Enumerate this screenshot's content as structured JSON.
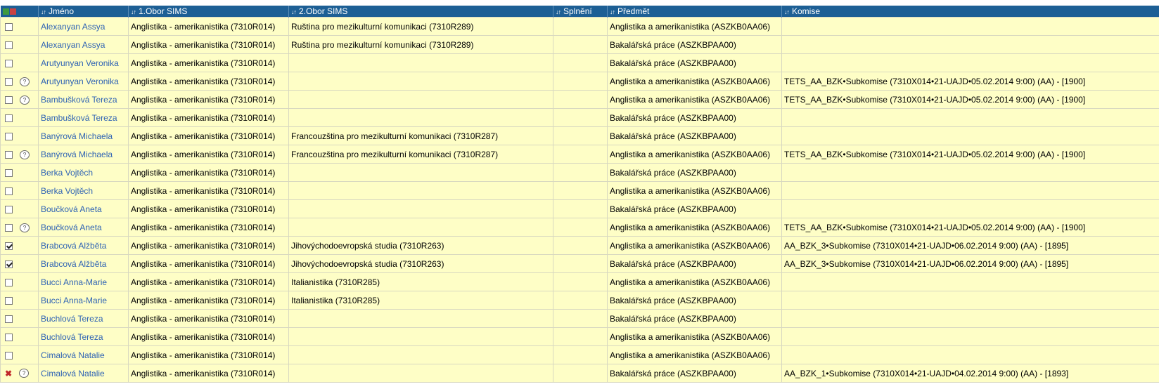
{
  "header": {
    "sort_glyph": "↓↑",
    "columns": [
      "Jméno",
      "1.Obor SIMS",
      "2.Obor SIMS",
      "Splnění",
      "Předmět",
      "Komise"
    ]
  },
  "rows": [
    {
      "checked": false,
      "note": false,
      "x": false,
      "name": "Alexanyan Assya",
      "obor1": "Anglistika - amerikanistika (7310R014)",
      "obor2": "Ruština pro mezikulturní komunikaci (7310R289)",
      "splneni": "",
      "predmet": "Anglistika a amerikanistika (ASZKB0AA06)",
      "komise": ""
    },
    {
      "checked": false,
      "note": false,
      "x": false,
      "name": "Alexanyan Assya",
      "obor1": "Anglistika - amerikanistika (7310R014)",
      "obor2": "Ruština pro mezikulturní komunikaci (7310R289)",
      "splneni": "",
      "predmet": "Bakalářská práce (ASZKBPAA00)",
      "komise": ""
    },
    {
      "checked": false,
      "note": false,
      "x": false,
      "name": "Arutyunyan Veronika",
      "obor1": "Anglistika - amerikanistika (7310R014)",
      "obor2": "",
      "splneni": "",
      "predmet": "Bakalářská práce (ASZKBPAA00)",
      "komise": ""
    },
    {
      "checked": false,
      "note": true,
      "x": false,
      "name": "Arutyunyan Veronika",
      "obor1": "Anglistika - amerikanistika (7310R014)",
      "obor2": "",
      "splneni": "",
      "predmet": "Anglistika a amerikanistika (ASZKB0AA06)",
      "komise": "TETS_AA_BZK•Subkomise (7310X014•21-UAJD•05.02.2014 9:00) (AA) - [1900]"
    },
    {
      "checked": false,
      "note": true,
      "x": false,
      "name": "Bambušková Tereza",
      "obor1": "Anglistika - amerikanistika (7310R014)",
      "obor2": "",
      "splneni": "",
      "predmet": "Anglistika a amerikanistika (ASZKB0AA06)",
      "komise": "TETS_AA_BZK•Subkomise (7310X014•21-UAJD•05.02.2014 9:00) (AA) - [1900]"
    },
    {
      "checked": false,
      "note": false,
      "x": false,
      "name": "Bambušková Tereza",
      "obor1": "Anglistika - amerikanistika (7310R014)",
      "obor2": "",
      "splneni": "",
      "predmet": "Bakalářská práce (ASZKBPAA00)",
      "komise": ""
    },
    {
      "checked": false,
      "note": false,
      "x": false,
      "name": "Banýrová Michaela",
      "obor1": "Anglistika - amerikanistika (7310R014)",
      "obor2": "Francouzština pro mezikulturní komunikaci (7310R287)",
      "splneni": "",
      "predmet": "Bakalářská práce (ASZKBPAA00)",
      "komise": ""
    },
    {
      "checked": false,
      "note": true,
      "x": false,
      "name": "Banýrová Michaela",
      "obor1": "Anglistika - amerikanistika (7310R014)",
      "obor2": "Francouzština pro mezikulturní komunikaci (7310R287)",
      "splneni": "",
      "predmet": "Anglistika a amerikanistika (ASZKB0AA06)",
      "komise": "TETS_AA_BZK•Subkomise (7310X014•21-UAJD•05.02.2014 9:00) (AA) - [1900]"
    },
    {
      "checked": false,
      "note": false,
      "x": false,
      "name": "Berka Vojtěch",
      "obor1": "Anglistika - amerikanistika (7310R014)",
      "obor2": "",
      "splneni": "",
      "predmet": "Bakalářská práce (ASZKBPAA00)",
      "komise": ""
    },
    {
      "checked": false,
      "note": false,
      "x": false,
      "name": "Berka Vojtěch",
      "obor1": "Anglistika - amerikanistika (7310R014)",
      "obor2": "",
      "splneni": "",
      "predmet": "Anglistika a amerikanistika (ASZKB0AA06)",
      "komise": ""
    },
    {
      "checked": false,
      "note": false,
      "x": false,
      "name": "Boučková Aneta",
      "obor1": "Anglistika - amerikanistika (7310R014)",
      "obor2": "",
      "splneni": "",
      "predmet": "Bakalářská práce (ASZKBPAA00)",
      "komise": ""
    },
    {
      "checked": false,
      "note": true,
      "x": false,
      "name": "Boučková Aneta",
      "obor1": "Anglistika - amerikanistika (7310R014)",
      "obor2": "",
      "splneni": "",
      "predmet": "Anglistika a amerikanistika (ASZKB0AA06)",
      "komise": "TETS_AA_BZK•Subkomise (7310X014•21-UAJD•05.02.2014 9:00) (AA) - [1900]"
    },
    {
      "checked": true,
      "note": false,
      "x": false,
      "name": "Brabcová Alžběta",
      "obor1": "Anglistika - amerikanistika (7310R014)",
      "obor2": "Jihovýchodoevropská studia (7310R263)",
      "splneni": "",
      "predmet": "Anglistika a amerikanistika (ASZKB0AA06)",
      "komise": "AA_BZK_3•Subkomise (7310X014•21-UAJD•06.02.2014 9:00) (AA) - [1895]"
    },
    {
      "checked": true,
      "note": false,
      "x": false,
      "name": "Brabcová Alžběta",
      "obor1": "Anglistika - amerikanistika (7310R014)",
      "obor2": "Jihovýchodoevropská studia (7310R263)",
      "splneni": "",
      "predmet": "Bakalářská práce (ASZKBPAA00)",
      "komise": "AA_BZK_3•Subkomise (7310X014•21-UAJD•06.02.2014 9:00) (AA) - [1895]"
    },
    {
      "checked": false,
      "note": false,
      "x": false,
      "name": "Bucci Anna-Marie",
      "obor1": "Anglistika - amerikanistika (7310R014)",
      "obor2": "Italianistika (7310R285)",
      "splneni": "",
      "predmet": "Anglistika a amerikanistika (ASZKB0AA06)",
      "komise": ""
    },
    {
      "checked": false,
      "note": false,
      "x": false,
      "name": "Bucci Anna-Marie",
      "obor1": "Anglistika - amerikanistika (7310R014)",
      "obor2": "Italianistika (7310R285)",
      "splneni": "",
      "predmet": "Bakalářská práce (ASZKBPAA00)",
      "komise": ""
    },
    {
      "checked": false,
      "note": false,
      "x": false,
      "name": "Buchlová Tereza",
      "obor1": "Anglistika - amerikanistika (7310R014)",
      "obor2": "",
      "splneni": "",
      "predmet": "Bakalářská práce (ASZKBPAA00)",
      "komise": ""
    },
    {
      "checked": false,
      "note": false,
      "x": false,
      "name": "Buchlová Tereza",
      "obor1": "Anglistika - amerikanistika (7310R014)",
      "obor2": "",
      "splneni": "",
      "predmet": "Anglistika a amerikanistika (ASZKB0AA06)",
      "komise": ""
    },
    {
      "checked": false,
      "note": false,
      "x": false,
      "name": "Cimalová Natalie",
      "obor1": "Anglistika - amerikanistika (7310R014)",
      "obor2": "",
      "splneni": "",
      "predmet": "Anglistika a amerikanistika (ASZKB0AA06)",
      "komise": ""
    },
    {
      "checked": false,
      "note": true,
      "x": true,
      "name": "Cimalová Natalie",
      "obor1": "Anglistika - amerikanistika (7310R014)",
      "obor2": "",
      "splneni": "",
      "predmet": "Bakalářská práce (ASZKBPAA00)",
      "komise": "AA_BZK_1•Subkomise (7310X014•21-UAJD•04.02.2014 9:00) (AA) - [1893]"
    }
  ]
}
